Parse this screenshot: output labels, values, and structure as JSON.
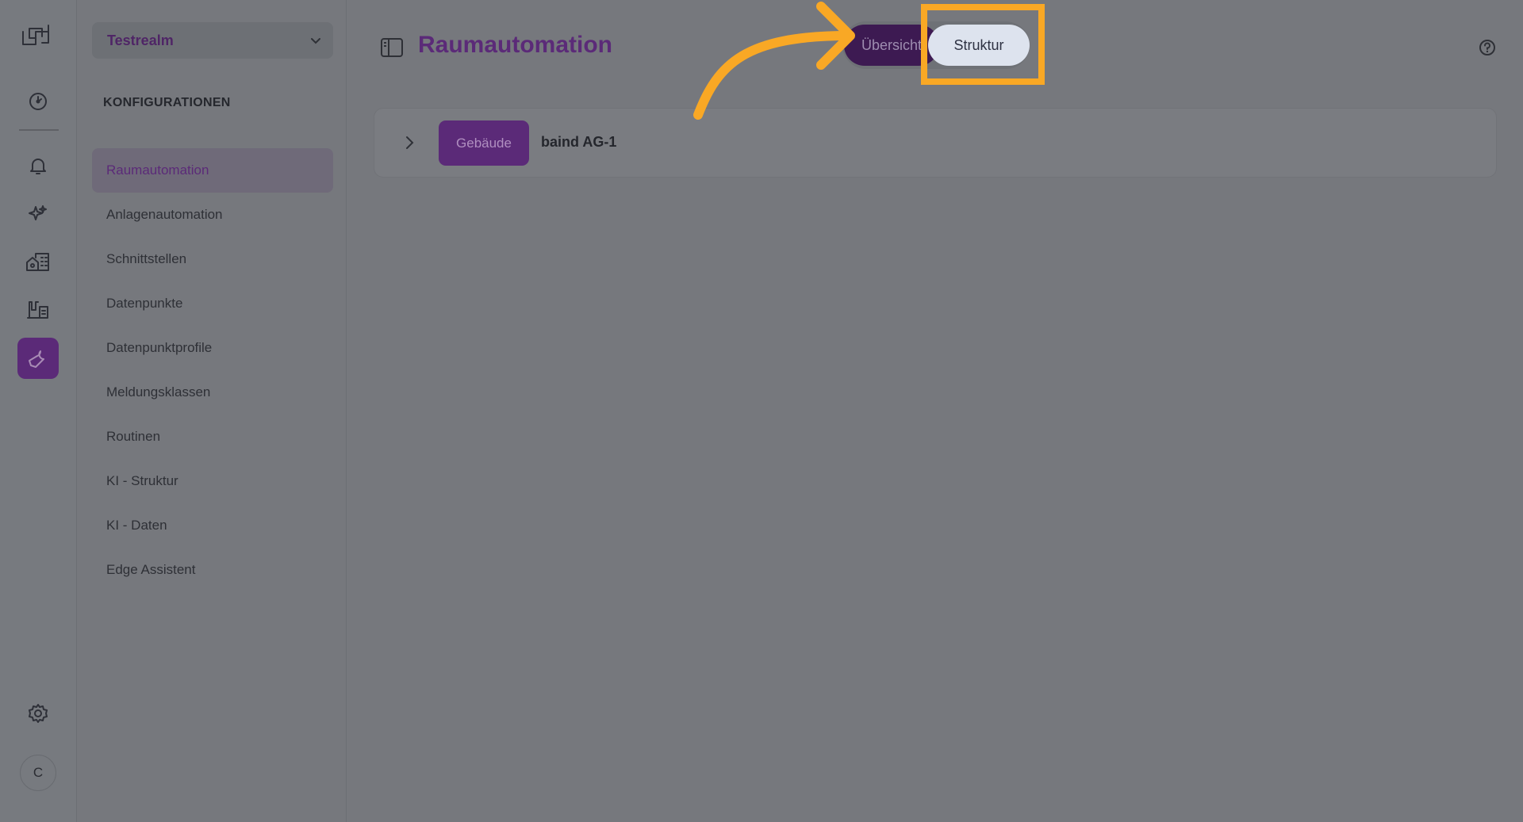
{
  "sidebar": {
    "realm": "Testrealm",
    "section_title": "KONFIGURATIONEN",
    "items": [
      {
        "label": "Raumautomation",
        "active": true
      },
      {
        "label": "Anlagenautomation"
      },
      {
        "label": "Schnittstellen"
      },
      {
        "label": "Datenpunkte"
      },
      {
        "label": "Datenpunktprofile"
      },
      {
        "label": "Meldungsklassen"
      },
      {
        "label": "Routinen"
      },
      {
        "label": "KI - Struktur"
      },
      {
        "label": "KI - Daten"
      },
      {
        "label": "Edge Assistent"
      }
    ]
  },
  "rail": {
    "icons": [
      "logo-icon",
      "dashboard-icon",
      "bell-icon",
      "sparkles-icon",
      "buildings-icon",
      "facility-icon",
      "wrench-icon",
      "gear-icon"
    ],
    "avatar_initial": "C"
  },
  "header": {
    "title": "Raumautomation",
    "toggle": {
      "left_label": "Übersicht",
      "right_label": "Struktur"
    }
  },
  "content": {
    "rows": [
      {
        "badge": "Gebäude",
        "name": "baind AG-1"
      }
    ]
  },
  "colors": {
    "accent": "#5b2a78",
    "highlight": "#f9a825"
  }
}
